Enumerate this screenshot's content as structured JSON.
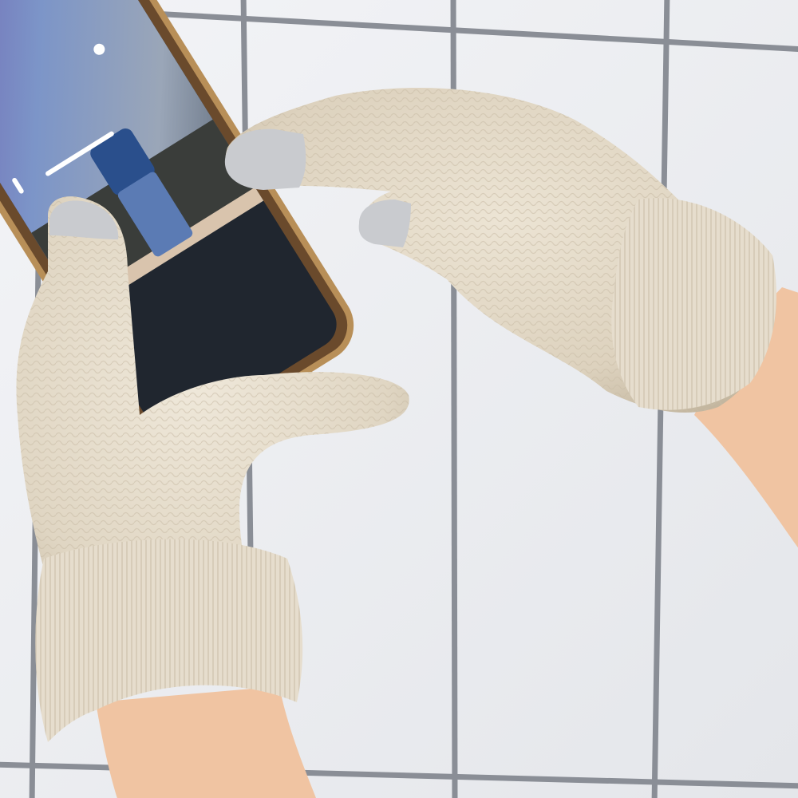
{
  "scene": {
    "subject": "gloved-hands-using-smartphone",
    "colors": {
      "tile": "#eef0f3",
      "grout": "#8a8e96",
      "glove": "#e2d8c6",
      "glove_shadow": "#c4b8a2",
      "glove_highlight": "#efe8da",
      "fingertip": "#c9cbcf",
      "skin": "#f2c8a8",
      "phone_frame": "#6a4a2c",
      "phone_rim": "#b88f58",
      "screen_dark": "#20262f",
      "photo_sky": "#7a8aa8",
      "photo_ground": "#3a3d3a",
      "photo_jeans": "#5b7bb4",
      "photo_shirt": "#2a4f8c"
    }
  }
}
